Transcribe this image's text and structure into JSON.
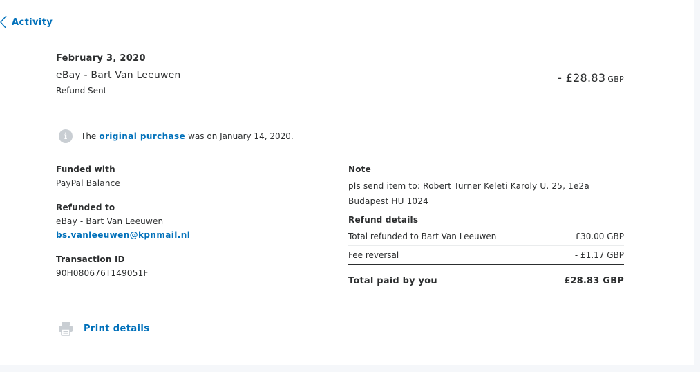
{
  "nav": {
    "back_label": "Activity"
  },
  "header": {
    "date": "February 3, 2020",
    "merchant": "eBay - Bart Van Leeuwen",
    "status": "Refund Sent",
    "amount": "- £28.83",
    "currency": "GBP"
  },
  "info": {
    "prefix": "The",
    "link": "original purchase",
    "suffix": "was on January 14, 2020."
  },
  "details": {
    "funded_with_label": "Funded with",
    "funded_with_value": "PayPal Balance",
    "refunded_to_label": "Refunded to",
    "refunded_to_name": "eBay - Bart Van Leeuwen",
    "refunded_to_email": "bs.vanleeuwen@kpnmail.nl",
    "transaction_id_label": "Transaction ID",
    "transaction_id_value": "90H080676T149051F"
  },
  "note": {
    "label": "Note",
    "text": "pls send item to: Robert Turner Keleti Karoly U. 25, 1e2a Budapest HU 1024"
  },
  "refund_details": {
    "label": "Refund details",
    "rows": [
      {
        "label": "Total refunded to Bart Van Leeuwen",
        "value": "£30.00 GBP"
      },
      {
        "label": "Fee reversal",
        "value": "- £1.17 GBP"
      }
    ],
    "total_label": "Total paid by you",
    "total_value": "£28.83 GBP"
  },
  "actions": {
    "print_label": "Print details"
  },
  "colors": {
    "link": "#0070ba",
    "text": "#2c2e2f",
    "icon": "#c9ced3"
  },
  "icons": {
    "back": "chevron-left-icon",
    "info": "info-icon",
    "print": "printer-icon"
  }
}
